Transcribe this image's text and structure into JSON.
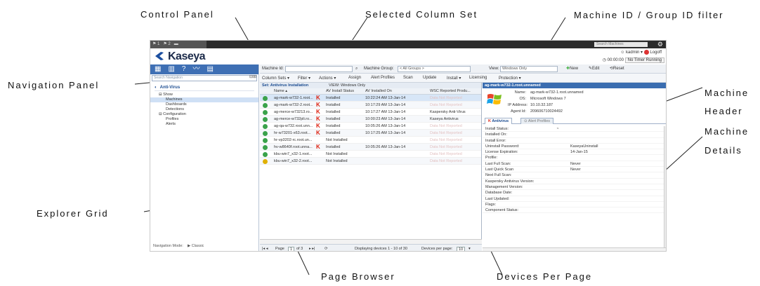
{
  "callouts": {
    "control_panel": "Control Panel",
    "selected_column_set": "Selected Column Set",
    "machine_id_filter": "Machine ID / Group ID filter",
    "navigation_panel": "Navigation Panel",
    "machine_header_1": "Machine",
    "machine_header_2": "Header",
    "machine_details_1": "Machine",
    "machine_details_2": "Details",
    "explorer_grid": "Explorer Grid",
    "page_browser": "Page Browser",
    "devices_per_page": "Devices Per Page"
  },
  "app": {
    "brand": "Kaseya",
    "search_placeholder": "Search Machines",
    "user": "kadmin ▾",
    "logoff": "Logoff",
    "timer": "00:00:00",
    "no_timer": "No Timer Running"
  },
  "nav": {
    "search_placeholder": "Search Navigation",
    "module": "Anti-Virus",
    "items": [
      {
        "label": "⊟ Show",
        "level": 1
      },
      {
        "label": "Machines",
        "level": 2,
        "selected": true
      },
      {
        "label": "Dashboards",
        "level": 2
      },
      {
        "label": "Detections",
        "level": 2
      },
      {
        "label": "⊟ Configuration",
        "level": 1
      },
      {
        "label": "Profiles",
        "level": 2
      },
      {
        "label": "Alerts",
        "level": 2
      }
    ],
    "mode_label": "Navigation Mode:",
    "mode_value": "Classic"
  },
  "filter": {
    "machine_id_label": "Machine Id:",
    "machine_group_label": "Machine Group:",
    "machine_group_value": "< All Groups >",
    "view_label": "View:",
    "view_value": "Windows Only",
    "new_label": "New",
    "edit_label": "Edit",
    "reset_label": "Reset"
  },
  "toolbar": {
    "column_sets": "Column Sets ▾",
    "filter": "Filter ▾",
    "actions": "Actions ▾",
    "assign": "Assign",
    "alert_profiles": "Alert Profiles",
    "scan": "Scan",
    "update": "Update",
    "install": "Install ▾",
    "licensing": "Licensing",
    "protection": "Protection ▾"
  },
  "grid": {
    "set_label": "Set: Antivirus Installation",
    "view_label": "VIEW: Windows Only",
    "headers": {
      "name": "Name ▴",
      "av_status": "AV Install Status",
      "av_installed_on": "AV Installed On",
      "wsc": "WSC Reported Produ..."
    },
    "rows": [
      {
        "name": "ag-mark-w732-1.root...",
        "k": true,
        "status": "Installed",
        "date": "10:22:24 AM 13-Jan-14",
        "wsc": "Data Not Reported",
        "sel": true
      },
      {
        "name": "ag-mark-w732-2.root...",
        "k": true,
        "status": "Installed",
        "date": "10:17:29 AM 13-Jan-14",
        "wsc": "Data Not Reported"
      },
      {
        "name": "ag-merce-w73213.ro...",
        "k": true,
        "status": "Installed",
        "date": "10:17:27 AM 13-Jan-14",
        "wsc": "Kaspersky Anti-Virus"
      },
      {
        "name": "ag-merce-w732pli.ro...",
        "k": true,
        "status": "Installed",
        "date": "10:00:23 AM 13-Jan-14",
        "wsc": "Kaseya Antivirus"
      },
      {
        "name": "ag-qa-w732.root.unn...",
        "k": true,
        "status": "Installed",
        "date": "10:05:26 AM 13-Jan-14",
        "wsc": "Data Not Reported"
      },
      {
        "name": "hr-w73201-x63.root...",
        "k": true,
        "status": "Installed",
        "date": "10:17:25 AM 13-Jan-14",
        "wsc": "Data Not Reported"
      },
      {
        "name": "hr-vp3202-rc.root.un...",
        "k": false,
        "status": "Not Installed",
        "date": "",
        "wsc": "Data Not Reported"
      },
      {
        "name": "hv-w8640f.root.unna...",
        "k": true,
        "status": "Installed",
        "date": "10:05:26 AM 13-Jan-14",
        "wsc": "Data Not Reported"
      },
      {
        "name": "kbu-win7_x32-1.root...",
        "k": false,
        "status": "Not Installed",
        "date": "",
        "wsc": "Data Not Reported"
      },
      {
        "name": "kbu-win7_x32-2.root...",
        "k": false,
        "status": "Not Installed",
        "date": "",
        "wsc": "Data Not Reported",
        "warn": true
      }
    ]
  },
  "pager": {
    "page_label": "Page",
    "page_value": "1",
    "of_label": "of 3",
    "displaying": "Displaying devices 1 - 10 of 30",
    "per_page_label": "Devices per page:",
    "per_page_value": "10"
  },
  "machine": {
    "title": "ag-mark-w732-1.root.unnamed",
    "name_label": "Name:",
    "name_value": "ag-mark-w732-1.root.unnamed",
    "os_label": "OS:",
    "os_value": "Microsoft Windows 7",
    "ip_label": "IP Address:",
    "ip_value": "10.10.32.187",
    "agent_label": "Agent Id:",
    "agent_value": "209606710024492",
    "tab_antivirus": "Antivirus",
    "tab_alert_profiles": "Alert Profiles",
    "details": [
      {
        "k": "Install Status:",
        "v": ""
      },
      {
        "k": "Installed On:",
        "v": ""
      },
      {
        "k": "Install Error:",
        "v": ""
      },
      {
        "k": "Uninstall Password:",
        "v": "KaseyaUninstall"
      },
      {
        "k": "License Expiration:",
        "v": "14-Jan-15"
      },
      {
        "k": "Profile:",
        "v": ""
      },
      {
        "k": "Last Full Scan:",
        "v": "Never"
      },
      {
        "k": "Last Quick Scan",
        "v": "Never"
      },
      {
        "k": "Next Full Scan:",
        "v": ""
      },
      {
        "k": "Kaspersky Antivirus Version:",
        "v": ""
      },
      {
        "k": "Management Version:",
        "v": ""
      },
      {
        "k": "Database Date:",
        "v": ""
      },
      {
        "k": "Last Updated:",
        "v": ""
      },
      {
        "k": "Flags:",
        "v": ""
      },
      {
        "k": "Component Status:",
        "v": ""
      }
    ]
  }
}
